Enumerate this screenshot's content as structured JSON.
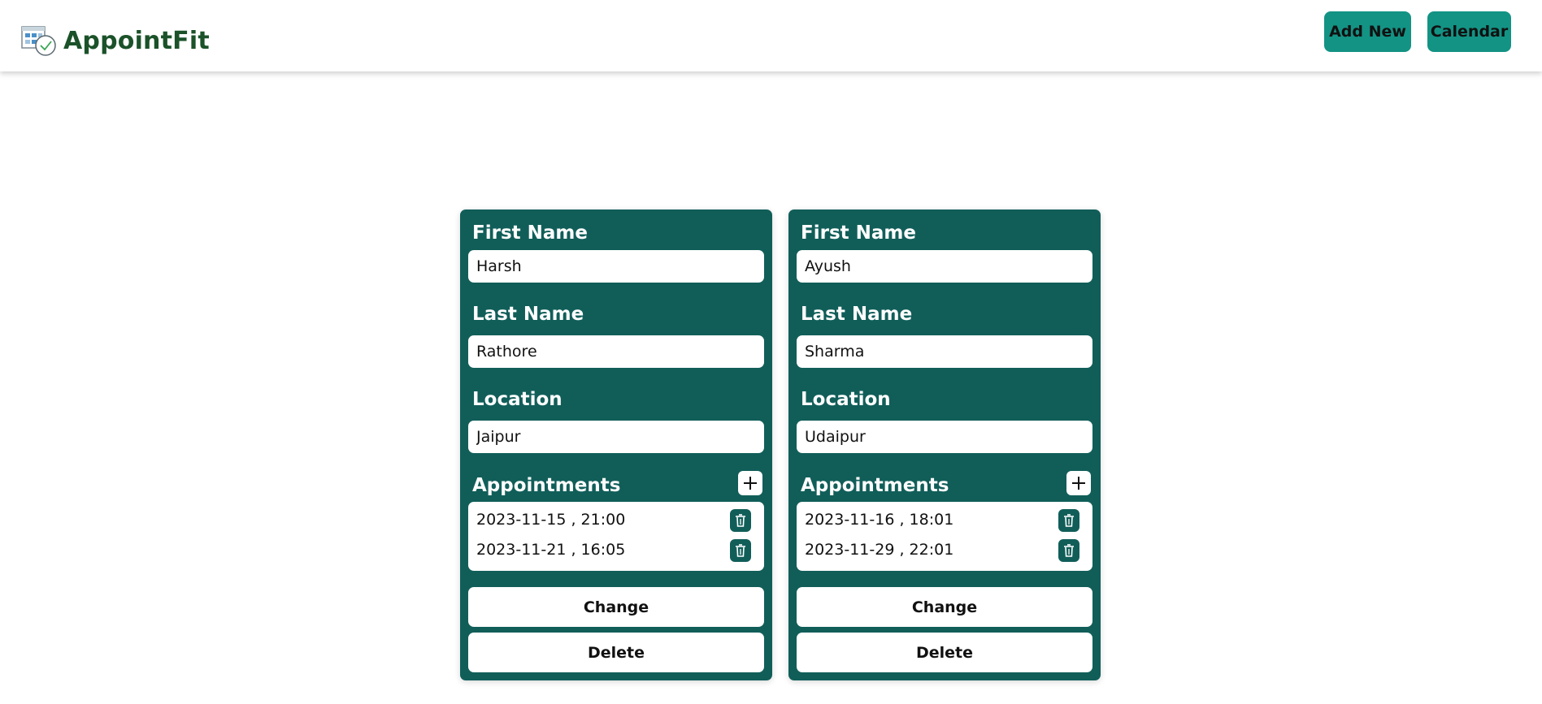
{
  "header": {
    "brand_name": "AppointFit",
    "brand_icon": "calendar-clock-icon",
    "add_new_label": "Add New",
    "calendar_label": "Calendar",
    "accent_color": "#139384",
    "brand_color": "#1b5229"
  },
  "labels": {
    "first_name": "First Name",
    "last_name": "Last Name",
    "location": "Location",
    "appointments": "Appointments",
    "change": "Change",
    "delete": "Delete"
  },
  "card_color": "#115e59",
  "cards": [
    {
      "first_name": "Harsh",
      "last_name": "Rathore",
      "location": "Jaipur",
      "appointments": [
        "2023-11-15 , 21:00",
        "2023-11-21 , 16:05"
      ]
    },
    {
      "first_name": "Ayush",
      "last_name": "Sharma",
      "location": "Udaipur",
      "appointments": [
        "2023-11-16 , 18:01",
        "2023-11-29 , 22:01"
      ]
    }
  ]
}
